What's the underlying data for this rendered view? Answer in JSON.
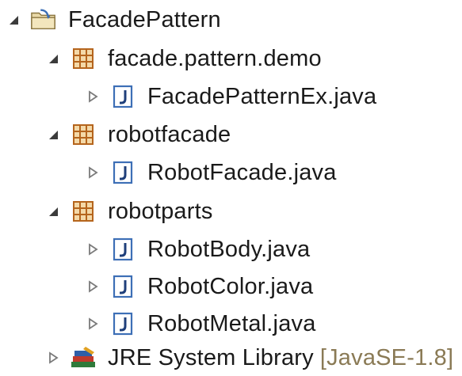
{
  "tree": {
    "project": {
      "label": "FacadePattern",
      "expanded": true,
      "icon": "project-folder-icon"
    },
    "packages": [
      {
        "label": "facade.pattern.demo",
        "expanded": true,
        "icon": "package-icon",
        "files": [
          {
            "label": "FacadePatternEx.java",
            "icon": "java-file-icon"
          }
        ]
      },
      {
        "label": "robotfacade",
        "expanded": true,
        "icon": "package-icon",
        "files": [
          {
            "label": "RobotFacade.java",
            "icon": "java-file-icon"
          }
        ]
      },
      {
        "label": "robotparts",
        "expanded": true,
        "icon": "package-icon",
        "files": [
          {
            "label": "RobotBody.java",
            "icon": "java-file-icon"
          },
          {
            "label": "RobotColor.java",
            "icon": "java-file-icon"
          },
          {
            "label": "RobotMetal.java",
            "icon": "java-file-icon"
          }
        ]
      }
    ],
    "library": {
      "label": "JRE System Library",
      "suffix": "[JavaSE-1.8]",
      "expanded": false,
      "icon": "library-books-icon"
    }
  },
  "colors": {
    "package_icon": "#b5651d",
    "java_icon_border": "#3d6fb6",
    "expander_filled": "#3b3b3b",
    "expander_hollow": "#7a7a7a",
    "library_suffix": "#8a7a55"
  }
}
